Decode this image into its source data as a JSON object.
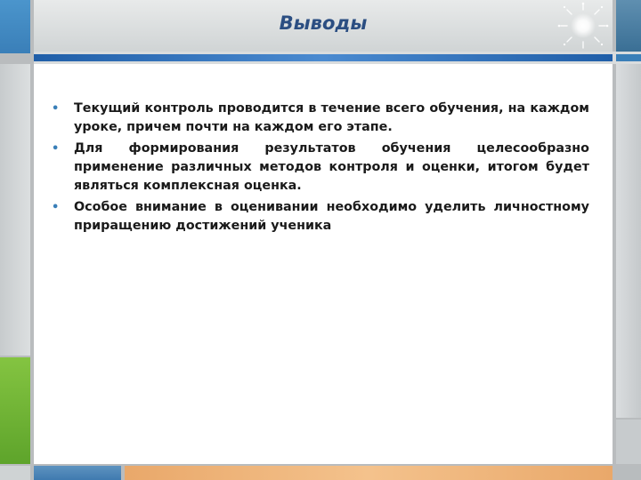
{
  "slide": {
    "title": "Выводы",
    "bullets": [
      "Текущий контроль проводится в течение всего обучения, на каждом уроке, причем почти на каждом его этапе.",
      "Для формирования результатов обучения целесообразно применение различных методов контроля и оценки, итогом будет являться комплексная оценка.",
      "Особое внимание в оценивании необходимо уделить личностному приращению достижений ученика"
    ],
    "bullet_glyph": "•"
  },
  "colors": {
    "title": "#2b4e82",
    "accent_blue": "#3a7fb8",
    "accent_green": "#6fb536",
    "accent_orange": "#f0b67c",
    "background": "#ffffff"
  },
  "icons": [
    "sparkle-icon"
  ]
}
